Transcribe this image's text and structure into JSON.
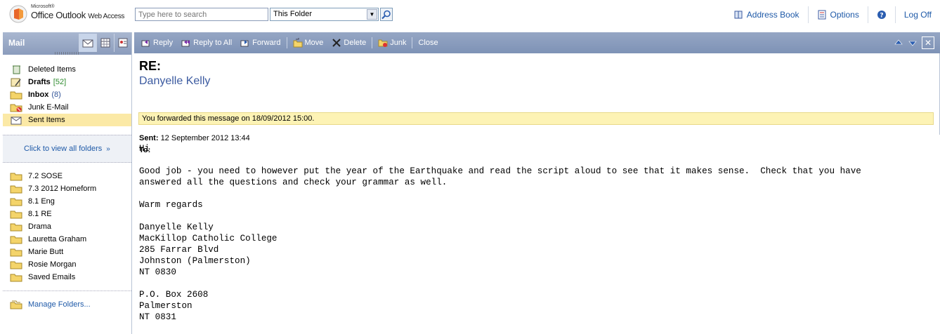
{
  "app": {
    "microsoft": "Microsoft®",
    "product": "Office Outlook",
    "product_suffix": "Web Access"
  },
  "search": {
    "placeholder": "Type here to search",
    "scope": "This Folder"
  },
  "top_links": [
    {
      "label": "Address Book",
      "icon": "address-book-icon"
    },
    {
      "label": "Options",
      "icon": "options-icon"
    },
    {
      "label": "",
      "icon": "help-icon"
    },
    {
      "label": "Log Off",
      "icon": ""
    }
  ],
  "nav": {
    "title": "Mail",
    "folders": [
      {
        "label": "Deleted Items",
        "count": "",
        "bold": false,
        "selected": false,
        "icon": "deleted-items-icon"
      },
      {
        "label": "Drafts",
        "count": "[52]",
        "bold": true,
        "selected": false,
        "icon": "drafts-icon"
      },
      {
        "label": "Inbox",
        "count": "(8)",
        "bold": true,
        "selected": false,
        "icon": "inbox-icon"
      },
      {
        "label": "Junk E-Mail",
        "count": "",
        "bold": false,
        "selected": false,
        "icon": "junk-icon"
      },
      {
        "label": "Sent Items",
        "count": "",
        "bold": false,
        "selected": true,
        "icon": "sent-items-icon"
      }
    ],
    "view_all": "Click to view all folders",
    "sub_folders": [
      "7.2 SOSE",
      "7.3 2012 Homeform",
      "8.1 Eng",
      "8.1 RE",
      "Drama",
      "Lauretta Graham",
      "Marie Butt",
      "Rosie Morgan",
      "Saved Emails"
    ],
    "manage": "Manage Folders..."
  },
  "toolbar": {
    "reply": "Reply",
    "reply_all": "Reply to All",
    "forward": "Forward",
    "move": "Move",
    "delete": "Delete",
    "junk": "Junk",
    "close": "Close"
  },
  "message": {
    "subject": "RE:",
    "sender": "Danyelle Kelly",
    "info": "You forwarded this message on 18/09/2012 15:00.",
    "sent_label": "Sent:",
    "sent_value": "12 September 2012 13:44",
    "to_label": "To:",
    "body": "Hi\n\nGood job - you need to however put the year of the Earthquake and read the script aloud to see that it makes sense.  Check that you have\nanswered all the questions and check your grammar as well.\n\nWarm regards\n\nDanyelle Kelly\nMacKillop Catholic College\n285 Farrar Blvd\nJohnston (Palmerston)\nNT 0830\n\nP.O. Box 2608\nPalmerston\nNT 0831"
  },
  "colors": {
    "toolbar": "#8a9cbd",
    "link": "#1f5aa8",
    "selected": "#fbe9a6",
    "infobar": "#fdf3b5"
  }
}
